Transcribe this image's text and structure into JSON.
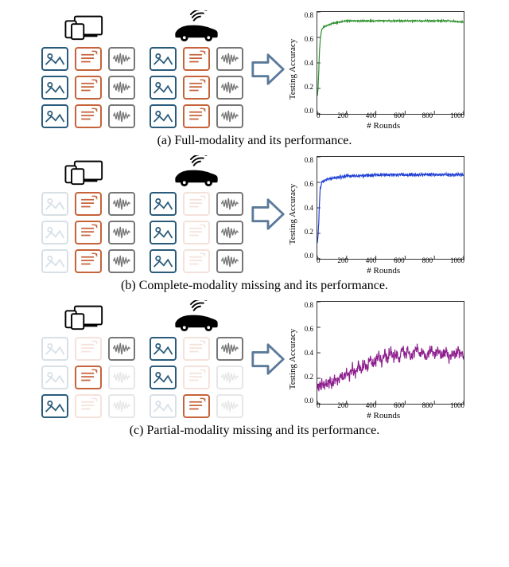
{
  "panels": [
    {
      "caption": "(a) Full-modality and its performance."
    },
    {
      "caption": "(b) Complete-modality missing and its performance."
    },
    {
      "caption": "(c) Partial-modality missing and its performance."
    }
  ],
  "axis": {
    "ylabel": "Testing Accuracy",
    "xlabel": "# Rounds"
  },
  "yticks": [
    "0.8",
    "0.6",
    "0.4",
    "0.2",
    "0.0"
  ],
  "xticks": [
    "0",
    "200",
    "400",
    "600",
    "800",
    "1000"
  ],
  "modalities": {
    "panel_a": {
      "client1": [
        [
          1,
          1,
          1
        ],
        [
          1,
          1,
          1
        ],
        [
          1,
          1,
          1
        ]
      ],
      "client2": [
        [
          1,
          1,
          1
        ],
        [
          1,
          1,
          1
        ],
        [
          1,
          1,
          1
        ]
      ]
    },
    "panel_b": {
      "client1": [
        [
          0,
          1,
          1
        ],
        [
          0,
          1,
          1
        ],
        [
          0,
          1,
          1
        ]
      ],
      "client2": [
        [
          1,
          0,
          1
        ],
        [
          1,
          0,
          1
        ],
        [
          1,
          0,
          1
        ]
      ]
    },
    "panel_c": {
      "client1": [
        [
          0,
          0,
          1
        ],
        [
          0,
          1,
          0
        ],
        [
          1,
          0,
          0
        ]
      ],
      "client2": [
        [
          1,
          0,
          1
        ],
        [
          1,
          0,
          0
        ],
        [
          0,
          1,
          0
        ]
      ]
    }
  },
  "chart_data": [
    {
      "type": "line",
      "series_name": "Full-modality",
      "color": "#2a8f2a",
      "xlabel": "# Rounds",
      "ylabel": "Testing Accuracy",
      "xlim": [
        0,
        1000
      ],
      "ylim": [
        0.0,
        0.8
      ],
      "x": [
        0,
        5,
        10,
        15,
        20,
        25,
        30,
        40,
        60,
        80,
        100,
        150,
        200,
        300,
        400,
        500,
        600,
        700,
        800,
        900,
        1000
      ],
      "y": [
        0.14,
        0.2,
        0.35,
        0.5,
        0.58,
        0.63,
        0.66,
        0.68,
        0.69,
        0.7,
        0.71,
        0.72,
        0.73,
        0.73,
        0.73,
        0.73,
        0.73,
        0.73,
        0.73,
        0.73,
        0.72
      ]
    },
    {
      "type": "line",
      "series_name": "Complete-modality missing",
      "color": "#1f3fd4",
      "xlabel": "# Rounds",
      "ylabel": "Testing Accuracy",
      "xlim": [
        0,
        1000
      ],
      "ylim": [
        0.0,
        0.8
      ],
      "x": [
        0,
        5,
        10,
        15,
        20,
        30,
        40,
        60,
        80,
        100,
        150,
        200,
        300,
        400,
        500,
        600,
        700,
        800,
        900,
        1000
      ],
      "y": [
        0.12,
        0.18,
        0.3,
        0.45,
        0.55,
        0.6,
        0.61,
        0.62,
        0.63,
        0.63,
        0.64,
        0.65,
        0.65,
        0.66,
        0.66,
        0.66,
        0.66,
        0.66,
        0.66,
        0.66
      ]
    },
    {
      "type": "line",
      "series_name": "Partial-modality missing",
      "color": "#8e1f8e",
      "xlabel": "# Rounds",
      "ylabel": "Testing Accuracy",
      "xlim": [
        0,
        1000
      ],
      "ylim": [
        0.0,
        0.8
      ],
      "x": [
        0,
        20,
        40,
        60,
        80,
        100,
        120,
        140,
        160,
        180,
        200,
        220,
        240,
        260,
        280,
        300,
        320,
        340,
        360,
        380,
        400,
        420,
        440,
        460,
        480,
        500,
        520,
        540,
        560,
        580,
        600,
        620,
        640,
        660,
        680,
        700,
        720,
        740,
        760,
        780,
        800,
        820,
        840,
        860,
        880,
        900,
        920,
        940,
        960,
        980,
        1000
      ],
      "y": [
        0.12,
        0.14,
        0.16,
        0.14,
        0.18,
        0.15,
        0.2,
        0.17,
        0.22,
        0.2,
        0.24,
        0.22,
        0.28,
        0.24,
        0.3,
        0.26,
        0.32,
        0.28,
        0.36,
        0.3,
        0.34,
        0.38,
        0.32,
        0.4,
        0.34,
        0.42,
        0.36,
        0.4,
        0.34,
        0.44,
        0.38,
        0.42,
        0.36,
        0.4,
        0.44,
        0.38,
        0.42,
        0.36,
        0.4,
        0.44,
        0.38,
        0.42,
        0.4,
        0.38,
        0.42,
        0.36,
        0.4,
        0.38,
        0.42,
        0.4,
        0.38
      ]
    }
  ]
}
